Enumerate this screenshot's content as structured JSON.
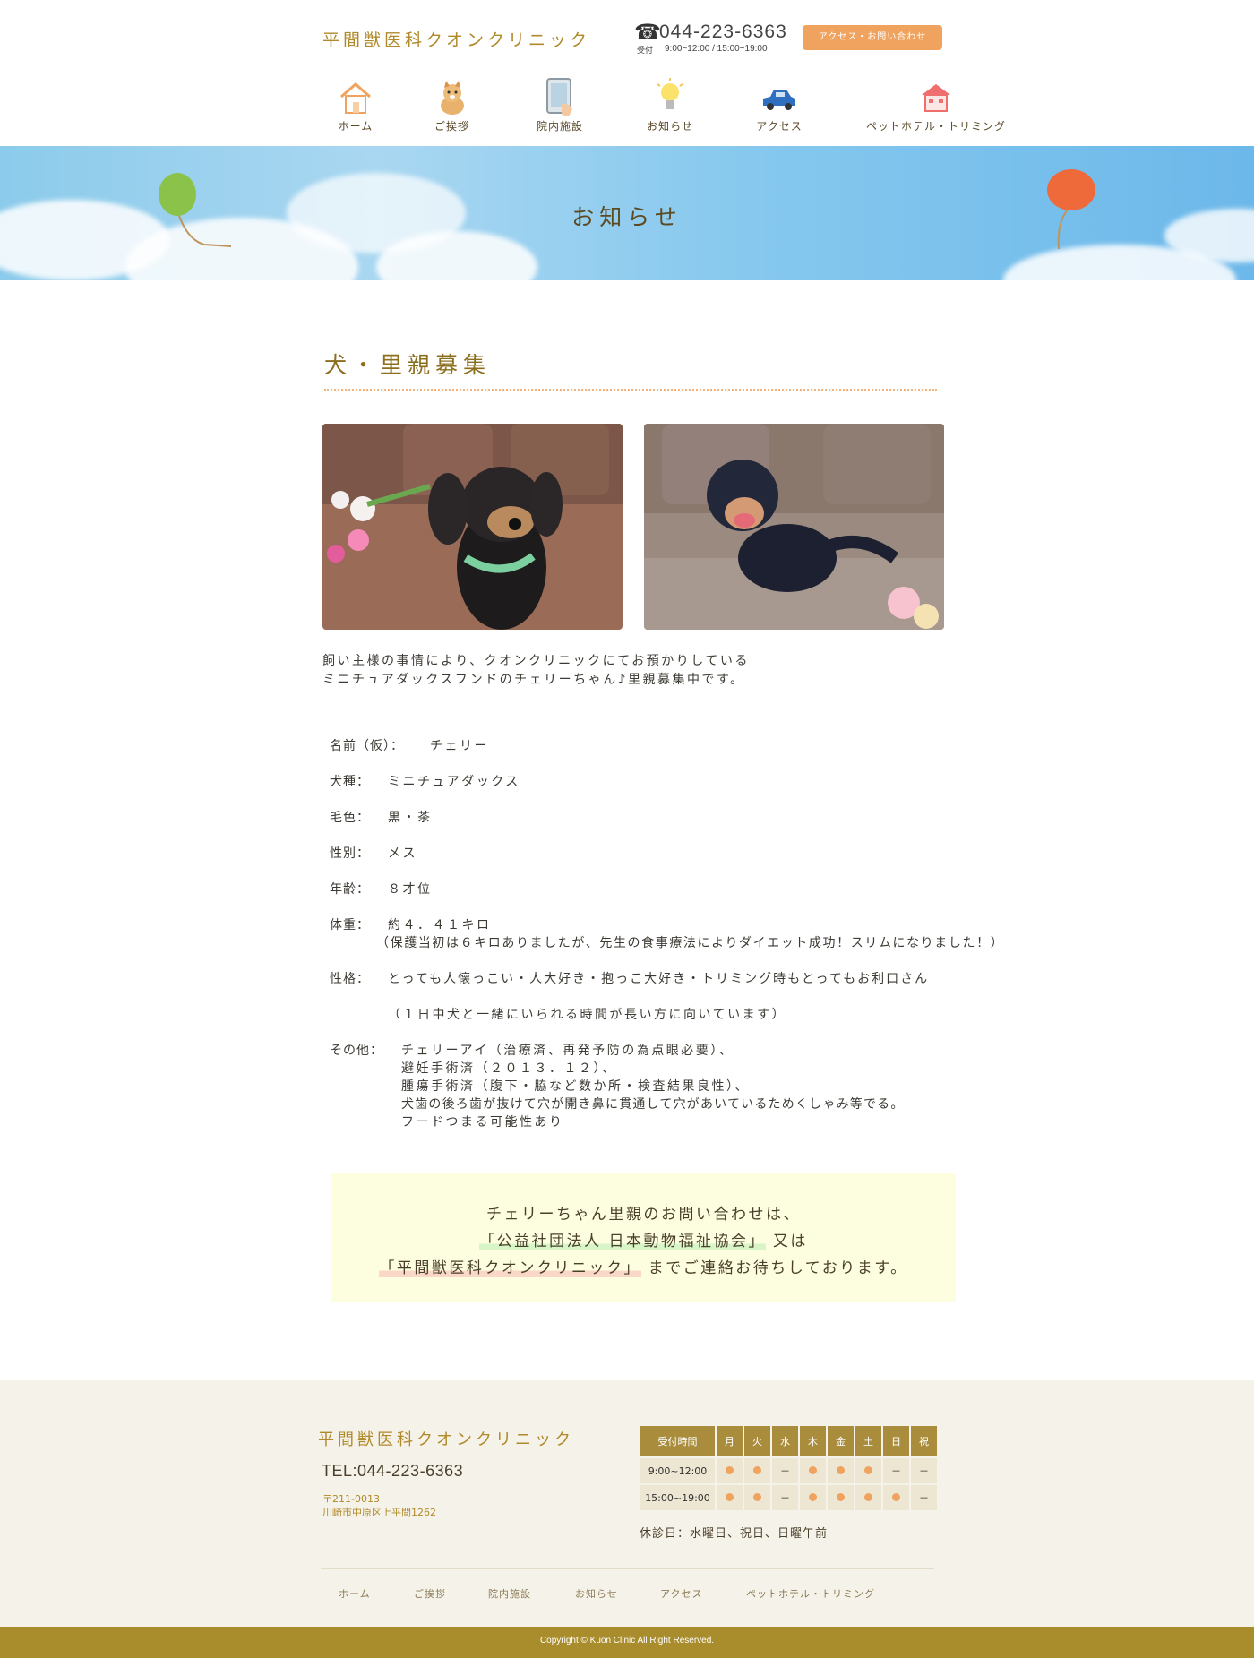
{
  "header": {
    "logo": "平間獣医科クオンクリニック",
    "phone": "044-223-6363",
    "reception_label": "受付",
    "reception_hours": "9:00~12:00 / 15:00~19:00",
    "contact_button": "アクセス・お問い合わせ"
  },
  "nav": [
    {
      "label": "ホーム",
      "icon": "house-icon"
    },
    {
      "label": "ご挨拶",
      "icon": "dog-icon"
    },
    {
      "label": "院内施設",
      "icon": "tablet-icon"
    },
    {
      "label": "お知らせ",
      "icon": "lightbulb-icon"
    },
    {
      "label": "アクセス",
      "icon": "car-icon"
    },
    {
      "label": "ペットホテル・トリミング",
      "icon": "pet-house-icon"
    }
  ],
  "banner": {
    "title": "お知らせ"
  },
  "article": {
    "title": "犬・里親募集",
    "intro": [
      "飼い主様の事情により、クオンクリニックにてお預かりしている",
      "ミニチュアダックスフンドのチェリーちゃん♪里親募集中です。"
    ],
    "profile": [
      {
        "label": "名前（仮）：",
        "values": [
          "チェリー"
        ]
      },
      {
        "label": "犬種：",
        "values": [
          "ミニチュアダックス"
        ]
      },
      {
        "label": "毛色：",
        "values": [
          "黒・茶"
        ]
      },
      {
        "label": "性別：",
        "values": [
          "メス"
        ]
      },
      {
        "label": "年齢：",
        "values": [
          "８才位"
        ]
      },
      {
        "label": "体重：",
        "values": [
          "約４．４１キロ",
          "（保護当初は６キロありましたが、先生の食事療法によりダイエット成功！スリムになりました！）"
        ]
      },
      {
        "label": "性格：",
        "values": [
          "とっても人懐っこい・人大好き・抱っこ大好き・トリミング時もとってもお利口さん",
          "（１日中犬と一緒にいられる時間が長い方に向いています）"
        ]
      },
      {
        "label": "その他：",
        "values": [
          "チェリーアイ（治療済、再発予防の為点眼必要）、",
          "避妊手術済（２０１３．１２）、",
          "腫瘍手術済（腹下・脇など数か所・検査結果良性）、",
          "犬歯の後ろ歯が抜けて穴が開き鼻に貫通して穴があいているためくしゃみ等でる。",
          "フードつまる可能性あり"
        ]
      }
    ]
  },
  "inquiry": {
    "line1": "チェリーちゃん里親のお問い合わせは、",
    "org1": "「公益社団法人 日本動物福祉協会」",
    "line2_suffix": " 又は",
    "org2": "「平間獣医科クオンクリニック」",
    "line3_suffix": " までご連絡お待ちしております。"
  },
  "footer": {
    "logo": "平間獣医科クオンクリニック",
    "tel": "TEL:044-223-6363",
    "postal": "〒211-0013",
    "address": "川崎市中原区上平間1262",
    "hours_table": {
      "header": [
        "受付時間",
        "月",
        "火",
        "水",
        "木",
        "金",
        "土",
        "日",
        "祝"
      ],
      "rows": [
        {
          "time": "9:00~12:00",
          "cells": [
            "●",
            "●",
            "－",
            "●",
            "●",
            "●",
            "－",
            "－"
          ]
        },
        {
          "time": "15:00~19:00",
          "cells": [
            "●",
            "●",
            "－",
            "●",
            "●",
            "●",
            "●",
            "－"
          ]
        }
      ]
    },
    "closed_days": "休診日：水曜日、祝日、日曜午前",
    "nav": [
      "ホーム",
      "ご挨拶",
      "院内施設",
      "お知らせ",
      "アクセス",
      "ペットホテル・トリミング"
    ],
    "copyright": "Copyright © Kuon Clinic All Right Reserved."
  },
  "colors": {
    "brand_gold": "#b08a2a",
    "accent_orange": "#f0a35e",
    "footer_bg": "#f5f2e9",
    "copyright_bg": "#a98d2c",
    "inquiry_bg": "#fdfde0"
  }
}
